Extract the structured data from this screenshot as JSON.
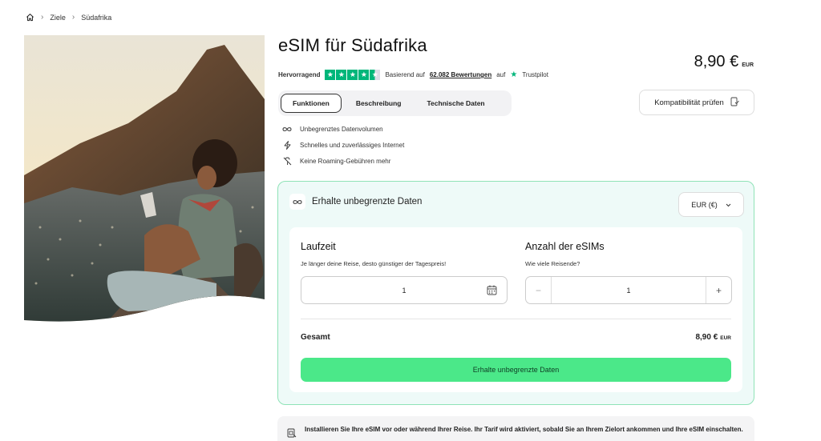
{
  "breadcrumb": {
    "home_icon": "home-icon",
    "items": [
      "Ziele",
      "Südafrika"
    ]
  },
  "product": {
    "title": "eSIM für Südafrika",
    "price": "8,90 €",
    "price_currency": "EUR"
  },
  "rating": {
    "label": "Hervorragend",
    "stars": 4.5,
    "based_on": "Basierend auf",
    "reviews_link": "62.082 Bewertungen",
    "on": "auf",
    "provider": "Trustpilot"
  },
  "tabs": [
    {
      "label": "Funktionen",
      "active": true
    },
    {
      "label": "Beschreibung",
      "active": false
    },
    {
      "label": "Technische Daten",
      "active": false
    }
  ],
  "compatibility_button": "Kompatibilität prüfen",
  "features": [
    {
      "icon": "infinity-icon",
      "label": "Unbegrenztes Datenvolumen"
    },
    {
      "icon": "lightning-icon",
      "label": "Schnelles und zuverlässiges Internet"
    },
    {
      "icon": "no-roaming-icon",
      "label": "Keine Roaming-Gebühren mehr"
    }
  ],
  "plan": {
    "title": "Erhalte unbegrenzte Daten",
    "currency_select": "EUR (€)",
    "duration": {
      "heading": "Laufzeit",
      "hint": "Je länger deine Reise, desto günstiger der Tagespreis!",
      "value": "1"
    },
    "esims": {
      "heading": "Anzahl der eSIMs",
      "hint": "Wie viele Reisende?",
      "value": "1",
      "minus": "−",
      "plus": "+"
    },
    "total_label": "Gesamt",
    "total_value": "8,90 €",
    "total_currency": "EUR",
    "cta": "Erhalte unbegrenzte Daten"
  },
  "notice": "Installieren Sie Ihre eSIM vor oder während Ihrer Reise. Ihr Tarif wird aktiviert, sobald Sie an Ihrem Zielort ankommen und Ihre eSIM einschalten.",
  "colors": {
    "accent_green": "#4be889",
    "card_border": "#8fe3b7",
    "trustpilot_green": "#00b67a"
  }
}
